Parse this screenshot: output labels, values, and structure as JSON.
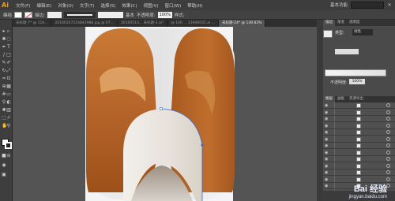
{
  "menubar": {
    "logo": "Ai",
    "items": [
      "文件(F)",
      "编辑(E)",
      "对象(O)",
      "文字(T)",
      "选择(S)",
      "效果(C)",
      "视图(V)",
      "窗口(W)",
      "帮助(H)"
    ],
    "workspace": "基本功能",
    "window_icon": "✕"
  },
  "controlbar": {
    "selection_label": "编组",
    "stroke_label": "描边:",
    "brush_label": "基本",
    "opacity_label": "不透明度:",
    "opacity_value": "100%",
    "style_label": "样式:"
  },
  "tabs": [
    {
      "label": "未标题-7* @ 116...",
      "active": false
    },
    {
      "label": "20160107224843988.jpg @ 67...",
      "active": false
    },
    {
      "label": "20160513... 未标题-3.ai*",
      "active": false
    },
    {
      "label": "@ 100 ... 13940035.ai ...",
      "active": false
    },
    {
      "label": "未标题-24* @ 139.83%",
      "active": true
    }
  ],
  "right_panel": {
    "tabs": [
      "描边",
      "渐变",
      "透明度"
    ],
    "stroke_label": "类型:",
    "stroke_value": "线性",
    "opacity_label": "不透明度:",
    "opacity_value": "100%"
  },
  "layers_panel": {
    "tabs": [
      "图层",
      "画板",
      "资源导出"
    ],
    "rows": 13
  },
  "colors": {
    "menubar": "#3d3d3d",
    "canvas": "#545454",
    "artboard": "#f4f4f4",
    "ear_brown": "#b8652a",
    "ear_light": "#e0a765",
    "face_white": "#eeeae5",
    "selection": "#3a6bd6"
  },
  "watermark": {
    "brand": "Bai 经验",
    "url": "jingyan.baidu.com"
  }
}
